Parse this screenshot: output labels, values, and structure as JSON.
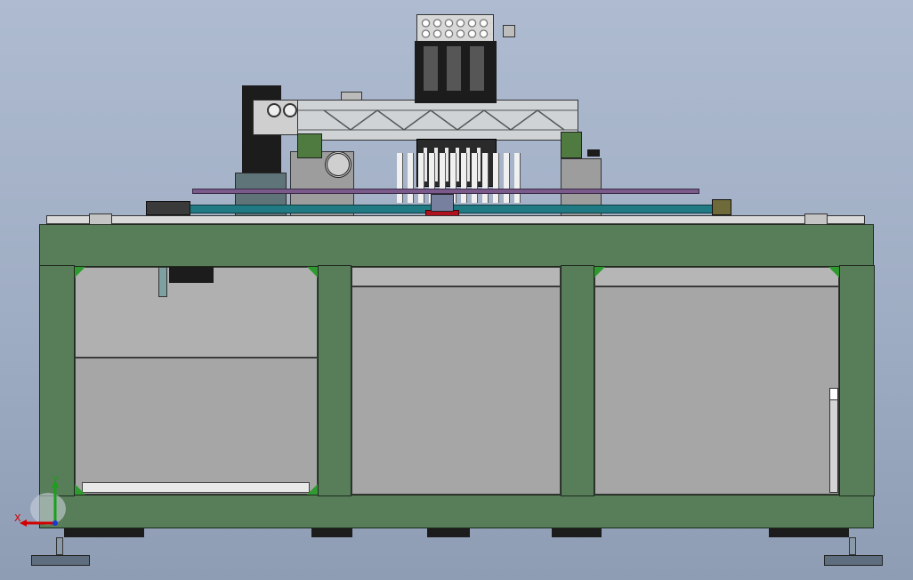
{
  "view": {
    "title": "",
    "background_top": "#aebbd0",
    "background_bottom": "#8e9cb4"
  },
  "colors": {
    "frame": "#587d59",
    "panel": "#a6a6a6",
    "rail_teal": "#1f7a83",
    "rail_purple": "#7a5a8a",
    "nozzle_red": "#b01020",
    "cabinet": "#5f7478"
  },
  "triad": {
    "x_label": "X",
    "y_label": "Y",
    "x_color": "#d10000",
    "y_color": "#1aa01a",
    "z_color": "#1a3ad1"
  },
  "icons": {
    "triad": "axis-triad-icon",
    "spool": "bearing-spool-icon"
  }
}
